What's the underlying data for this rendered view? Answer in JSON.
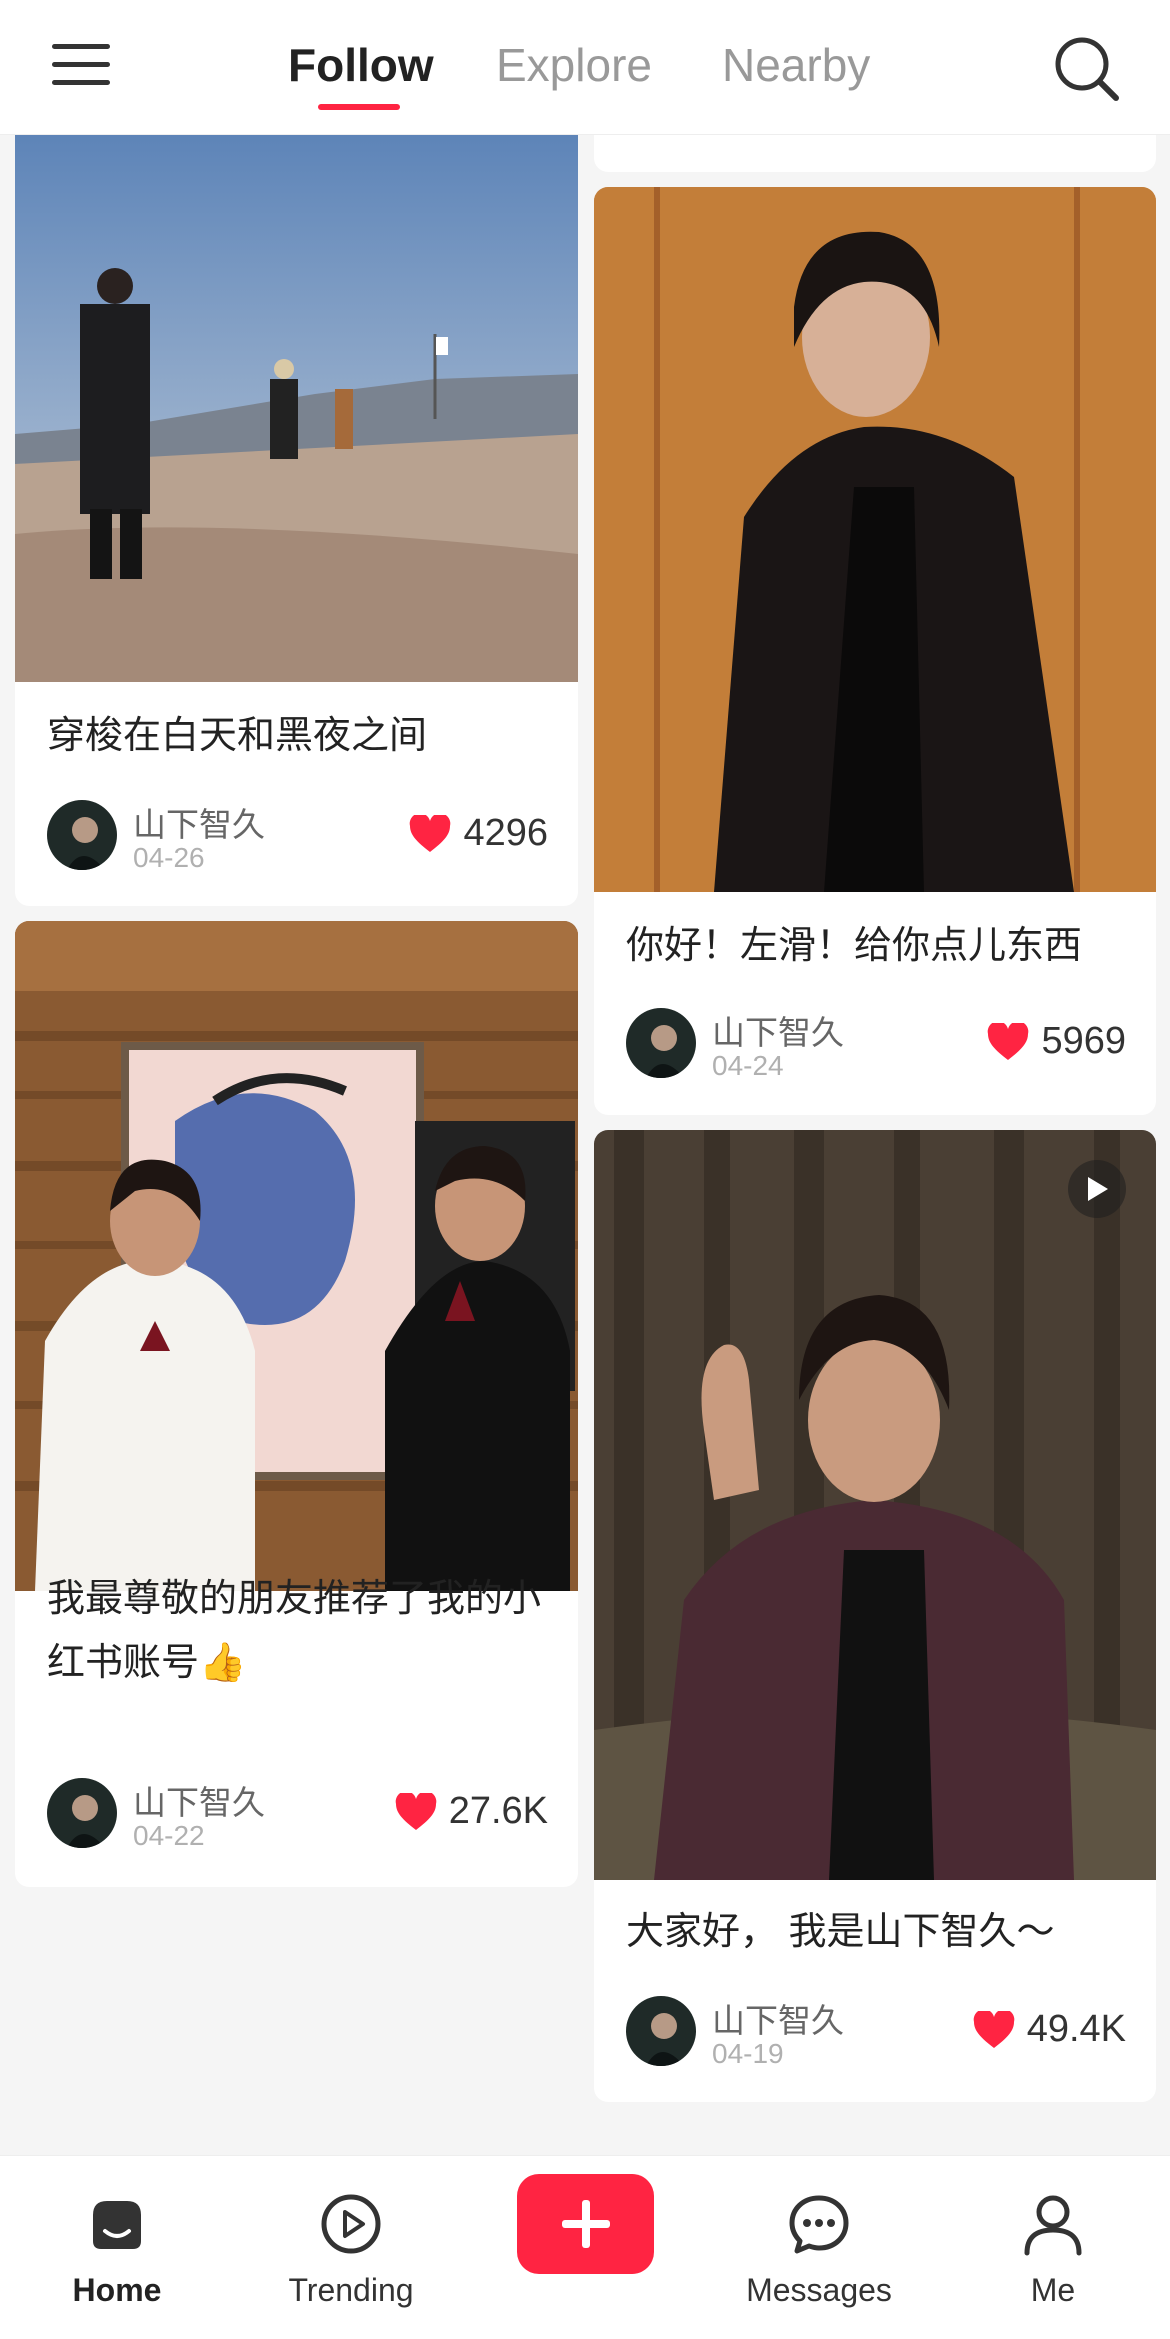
{
  "top_nav": {
    "tabs": [
      {
        "label": "Follow",
        "active": true
      },
      {
        "label": "Explore",
        "active": false
      },
      {
        "label": "Nearby",
        "active": false
      }
    ],
    "accent_color": "#ff2442"
  },
  "feed": {
    "posts": [
      {
        "title": "穿梭在白天和黑夜之间",
        "author": "山下智久",
        "date": "04-26",
        "likes": "4296"
      },
      {
        "title": "你好！左滑！给你点儿东西",
        "author": "山下智久",
        "date": "04-24",
        "likes": "5969"
      },
      {
        "title": "我最尊敬的朋友推荐了我的小红书账号👍",
        "author": "山下智久",
        "date": "04-22",
        "likes": "27.6K"
      },
      {
        "title": "大家好， 我是山下智久～",
        "author": "山下智久",
        "date": "04-19",
        "likes": "49.4K",
        "is_video": true
      }
    ]
  },
  "bottom_nav": {
    "items": [
      {
        "label": "Home",
        "icon": "home-icon",
        "active": true
      },
      {
        "label": "Trending",
        "icon": "play-circle-icon"
      },
      {
        "label": "",
        "icon": "plus-icon"
      },
      {
        "label": "Messages",
        "icon": "chat-bubble-icon"
      },
      {
        "label": "Me",
        "icon": "person-icon"
      }
    ]
  }
}
